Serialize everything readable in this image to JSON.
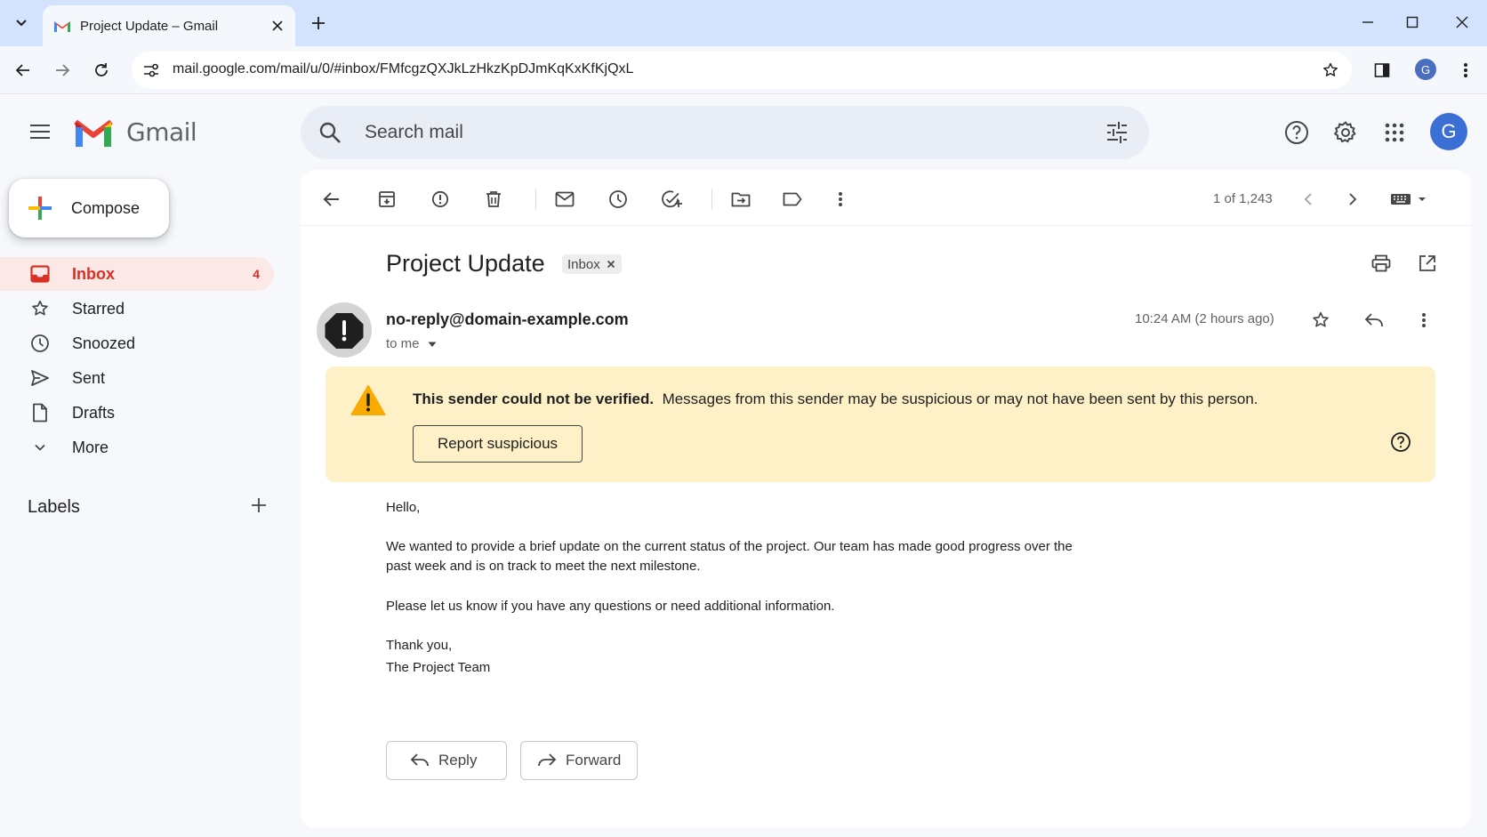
{
  "browser": {
    "tab_title": "Project Update – Gmail",
    "url": "mail.google.com/mail/u/0/#inbox/FMfcgzQXJkLzHkzKpDJmKqKxKfKjQxL",
    "profile_initial": "G"
  },
  "header": {
    "app_name": "Gmail",
    "search_placeholder": "Search mail",
    "account_initial": "G"
  },
  "sidebar": {
    "compose_label": "Compose",
    "items": [
      {
        "label": "Inbox",
        "count": "4",
        "icon": "inbox-icon",
        "active": true
      },
      {
        "label": "Starred",
        "icon": "star-icon"
      },
      {
        "label": "Snoozed",
        "icon": "clock-icon"
      },
      {
        "label": "Sent",
        "icon": "send-icon"
      },
      {
        "label": "Drafts",
        "icon": "draft-icon"
      },
      {
        "label": "More",
        "icon": "chevron-down-icon"
      }
    ],
    "labels_heading": "Labels"
  },
  "toolbar": {
    "pager_text": "1 of 1,243"
  },
  "message": {
    "subject": "Project Update",
    "label_chip": "Inbox",
    "sender_email": "no-reply@domain-example.com",
    "recipient_text": "to me",
    "timestamp": "10:24 AM (2 hours ago)",
    "warning": {
      "title": "This sender could not be verified.",
      "text": "Messages from this sender may be suspicious or may not have been sent by this person.",
      "button_label": "Report suspicious"
    },
    "body": {
      "greeting": "Hello,",
      "paragraph1_line1": "We wanted to provide a brief update on the current status of the project. Our team has made good progress over the",
      "paragraph1_line2": "past week and is on track to meet the next milestone.",
      "paragraph2": "Please let us know if you have any questions or need additional information.",
      "signoff": "Thank you,",
      "signature": "The Project Team"
    },
    "reply_label": "Reply",
    "forward_label": "Forward"
  },
  "colors": {
    "accent_red": "#d93025",
    "warning_bg": "#fef0c7",
    "warning_icon": "#f9ab00",
    "tab_strip": "#d3e3fd",
    "account_blue": "#3c6fd6"
  }
}
